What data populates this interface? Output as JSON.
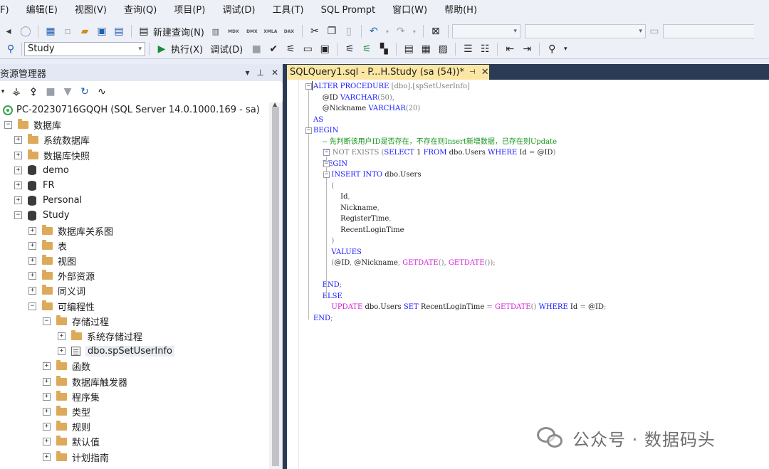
{
  "menu": [
    "F)",
    "编辑(E)",
    "视图(V)",
    "查询(Q)",
    "项目(P)",
    "调试(D)",
    "工具(T)",
    "SQL Prompt",
    "窗口(W)",
    "帮助(H)"
  ],
  "toolbar1": {
    "new_query_label": "新建查询(N)",
    "db_icons": [
      "MDX",
      "DMX",
      "XMLA",
      "DAX"
    ]
  },
  "toolbar2": {
    "database_selected": "Study",
    "execute_label": "执行(X)",
    "debug_label": "调试(D)"
  },
  "object_explorer": {
    "title": "资源管理器",
    "tree": [
      {
        "label": "PC-20230716GQQH (SQL Server 14.0.1000.169 - sa)",
        "icon": "server-icon",
        "level": 0,
        "expander": "minus"
      },
      {
        "label": "数据库",
        "icon": "folder-icon",
        "level": 1,
        "expander": "minus"
      },
      {
        "label": "系统数据库",
        "icon": "folder-icon",
        "level": 2,
        "expander": "plus"
      },
      {
        "label": "数据库快照",
        "icon": "folder-icon",
        "level": 2,
        "expander": "plus"
      },
      {
        "label": "demo",
        "icon": "database-icon",
        "level": 2,
        "expander": "plus"
      },
      {
        "label": "FR",
        "icon": "database-icon",
        "level": 2,
        "expander": "plus"
      },
      {
        "label": "Personal",
        "icon": "database-icon",
        "level": 2,
        "expander": "plus"
      },
      {
        "label": "Study",
        "icon": "database-icon",
        "level": 2,
        "expander": "minus"
      },
      {
        "label": "数据库关系图",
        "icon": "folder-icon",
        "level": 3,
        "expander": "plus"
      },
      {
        "label": "表",
        "icon": "folder-icon",
        "level": 3,
        "expander": "plus"
      },
      {
        "label": "视图",
        "icon": "folder-icon",
        "level": 3,
        "expander": "plus"
      },
      {
        "label": "外部资源",
        "icon": "folder-icon",
        "level": 3,
        "expander": "plus"
      },
      {
        "label": "同义词",
        "icon": "folder-icon",
        "level": 3,
        "expander": "plus"
      },
      {
        "label": "可编程性",
        "icon": "folder-icon",
        "level": 3,
        "expander": "minus"
      },
      {
        "label": "存储过程",
        "icon": "folder-icon",
        "level": 4,
        "expander": "minus"
      },
      {
        "label": "系统存储过程",
        "icon": "folder-icon",
        "level": 5,
        "expander": "plus"
      },
      {
        "label": "dbo.spSetUserInfo",
        "icon": "stored-procedure-icon",
        "level": 5,
        "expander": "plus",
        "selected": true
      },
      {
        "label": "函数",
        "icon": "folder-icon",
        "level": 4,
        "expander": "plus"
      },
      {
        "label": "数据库触发器",
        "icon": "folder-icon",
        "level": 4,
        "expander": "plus"
      },
      {
        "label": "程序集",
        "icon": "folder-icon",
        "level": 4,
        "expander": "plus"
      },
      {
        "label": "类型",
        "icon": "folder-icon",
        "level": 4,
        "expander": "plus"
      },
      {
        "label": "规则",
        "icon": "folder-icon",
        "level": 4,
        "expander": "plus"
      },
      {
        "label": "默认值",
        "icon": "folder-icon",
        "level": 4,
        "expander": "plus"
      },
      {
        "label": "计划指南",
        "icon": "folder-icon",
        "level": 4,
        "expander": "plus"
      }
    ]
  },
  "editor": {
    "tab_title": "SQLQuery1.sql - P...H.Study (sa (54))*",
    "code_lines": [
      {
        "tokens": [
          [
            "kw",
            "ALTER PROCEDURE "
          ],
          [
            "gray",
            "[dbo]"
          ],
          [
            "id",
            "."
          ],
          [
            "gray",
            "[spSetUserInfo]"
          ]
        ]
      },
      {
        "tokens": [
          [
            "id",
            "    @ID "
          ],
          [
            "ty",
            "VARCHAR"
          ],
          [
            "gray",
            "(50),"
          ]
        ]
      },
      {
        "tokens": [
          [
            "id",
            "    @Nickname "
          ],
          [
            "ty",
            "VARCHAR"
          ],
          [
            "gray",
            "(20)"
          ]
        ]
      },
      {
        "tokens": [
          [
            "kw",
            "AS"
          ]
        ]
      },
      {
        "tokens": [
          [
            "kw",
            "BEGIN"
          ]
        ]
      },
      {
        "tokens": [
          [
            "cm",
            "    -- 先判断该用户ID是否存在，不存在则Insert新增数据，已存在则Update"
          ]
        ]
      },
      {
        "tokens": [
          [
            "kw",
            "    IF "
          ],
          [
            "gray",
            "NOT EXISTS "
          ],
          [
            "gray",
            "("
          ],
          [
            "kw",
            "SELECT "
          ],
          [
            "id",
            "1 "
          ],
          [
            "kw",
            "FROM "
          ],
          [
            "id",
            "dbo.Users "
          ],
          [
            "kw",
            "WHERE "
          ],
          [
            "id",
            "Id "
          ],
          [
            "gray",
            "= "
          ],
          [
            "id",
            "@ID"
          ],
          [
            "gray",
            ")"
          ]
        ]
      },
      {
        "tokens": [
          [
            "kw",
            "    BEGIN"
          ]
        ]
      },
      {
        "tokens": [
          [
            "kw",
            "        INSERT INTO "
          ],
          [
            "id",
            "dbo.Users"
          ]
        ]
      },
      {
        "tokens": [
          [
            "gray",
            "        ("
          ]
        ]
      },
      {
        "tokens": [
          [
            "id",
            "            Id"
          ],
          [
            "gray",
            ","
          ]
        ]
      },
      {
        "tokens": [
          [
            "id",
            "            Nickname"
          ],
          [
            "gray",
            ","
          ]
        ]
      },
      {
        "tokens": [
          [
            "id",
            "            RegisterTime"
          ],
          [
            "gray",
            ","
          ]
        ]
      },
      {
        "tokens": [
          [
            "id",
            "            RecentLoginTime"
          ]
        ]
      },
      {
        "tokens": [
          [
            "gray",
            "        )"
          ]
        ]
      },
      {
        "tokens": [
          [
            "kw",
            "        VALUES"
          ]
        ]
      },
      {
        "tokens": [
          [
            "gray",
            "        ("
          ],
          [
            "id",
            "@ID"
          ],
          [
            "gray",
            ", "
          ],
          [
            "id",
            "@Nickname"
          ],
          [
            "gray",
            ", "
          ],
          [
            "fn",
            "GETDATE"
          ],
          [
            "gray",
            "(), "
          ],
          [
            "fn",
            "GETDATE"
          ],
          [
            "gray",
            "());"
          ]
        ]
      },
      {
        "tokens": [
          [
            "id",
            ""
          ]
        ]
      },
      {
        "tokens": [
          [
            "kw",
            "    END"
          ],
          [
            "gray",
            ";"
          ]
        ]
      },
      {
        "tokens": [
          [
            "kw",
            "    ELSE"
          ]
        ]
      },
      {
        "tokens": [
          [
            "fn",
            "        UPDATE "
          ],
          [
            "id",
            "dbo.Users "
          ],
          [
            "kw",
            "SET "
          ],
          [
            "id",
            "RecentLoginTime "
          ],
          [
            "gray",
            "= "
          ],
          [
            "fn",
            "GETDATE"
          ],
          [
            "gray",
            "() "
          ],
          [
            "kw",
            "WHERE "
          ],
          [
            "id",
            "Id "
          ],
          [
            "gray",
            "= "
          ],
          [
            "id",
            "@ID"
          ],
          [
            "gray",
            ";"
          ]
        ]
      },
      {
        "tokens": [
          [
            "kw",
            "END"
          ],
          [
            "gray",
            ";"
          ]
        ]
      }
    ]
  },
  "watermark": {
    "text": "公众号 · 数据码头"
  }
}
